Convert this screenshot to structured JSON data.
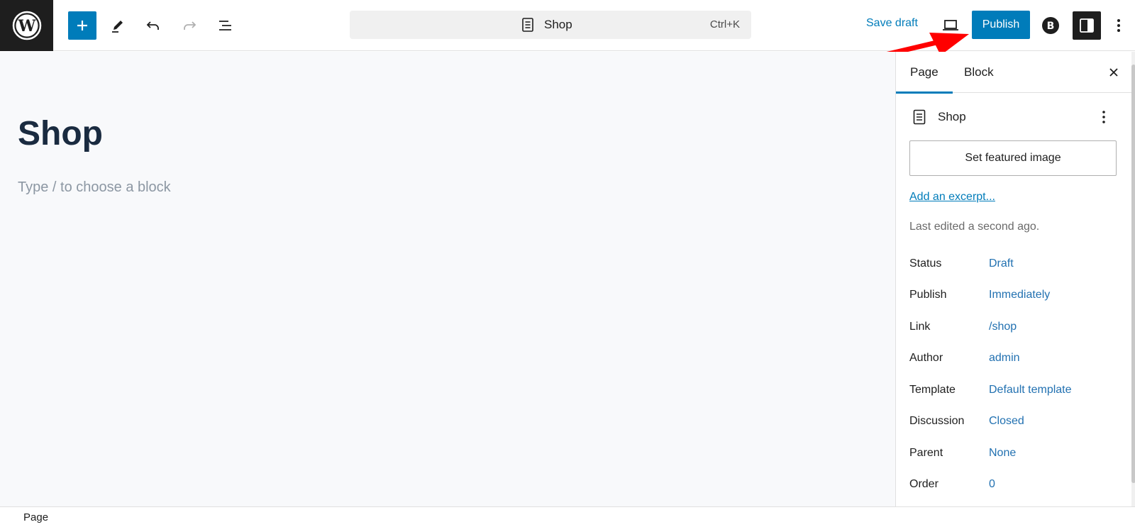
{
  "header": {
    "document_title": "Shop",
    "shortcut": "Ctrl+K",
    "save_draft_label": "Save draft",
    "publish_label": "Publish"
  },
  "editor": {
    "title": "Shop",
    "placeholder": "Type / to choose a block"
  },
  "sidebar": {
    "tabs": [
      {
        "label": "Page",
        "active": true
      },
      {
        "label": "Block",
        "active": false
      }
    ],
    "document_title": "Shop",
    "featured_image_label": "Set featured image",
    "excerpt_label": "Add an excerpt...",
    "last_edited": "Last edited a second ago.",
    "properties": [
      {
        "label": "Status",
        "value": "Draft"
      },
      {
        "label": "Publish",
        "value": "Immediately"
      },
      {
        "label": "Link",
        "value": "/shop"
      },
      {
        "label": "Author",
        "value": "admin"
      },
      {
        "label": "Template",
        "value": "Default template"
      },
      {
        "label": "Discussion",
        "value": "Closed"
      },
      {
        "label": "Parent",
        "value": "None"
      },
      {
        "label": "Order",
        "value": "0"
      }
    ]
  },
  "footer": {
    "breadcrumb": "Page"
  },
  "colors": {
    "accent": "#007cba",
    "annotation_arrow": "#ff0000"
  }
}
